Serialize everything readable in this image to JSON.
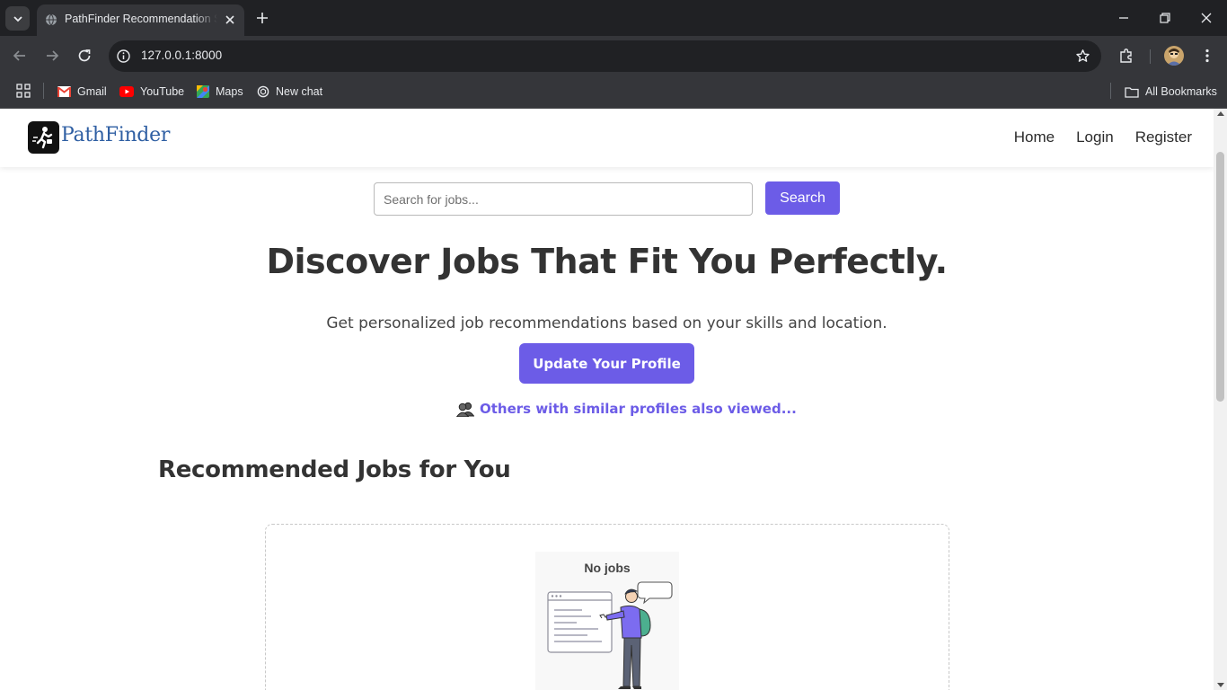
{
  "browser": {
    "tab_title": "PathFinder Recommendation System",
    "url": "127.0.0.1:8000",
    "bookmarks": [
      {
        "label": "Gmail",
        "icon": "gmail-icon"
      },
      {
        "label": "YouTube",
        "icon": "youtube-icon"
      },
      {
        "label": "Maps",
        "icon": "maps-icon"
      },
      {
        "label": "New chat",
        "icon": "chatgpt-icon"
      }
    ],
    "all_bookmarks_label": "All Bookmarks"
  },
  "navbar": {
    "brand": "PathFinder",
    "links": [
      "Home",
      "Login",
      "Register"
    ]
  },
  "search": {
    "placeholder": "Search for jobs...",
    "value": "",
    "button_label": "Search"
  },
  "hero": {
    "title": "Discover Jobs That Fit You Perfectly.",
    "subtitle": "Get personalized job recommendations based on your skills and location.",
    "cta_label": "Update Your Profile",
    "similar_link": "Others with similar profiles also viewed..."
  },
  "recommended": {
    "heading": "Recommended Jobs for You",
    "empty_label": "No jobs"
  },
  "colors": {
    "accent": "#6c5ce7",
    "brand_text": "#2f5fa3",
    "heading": "#333333"
  }
}
